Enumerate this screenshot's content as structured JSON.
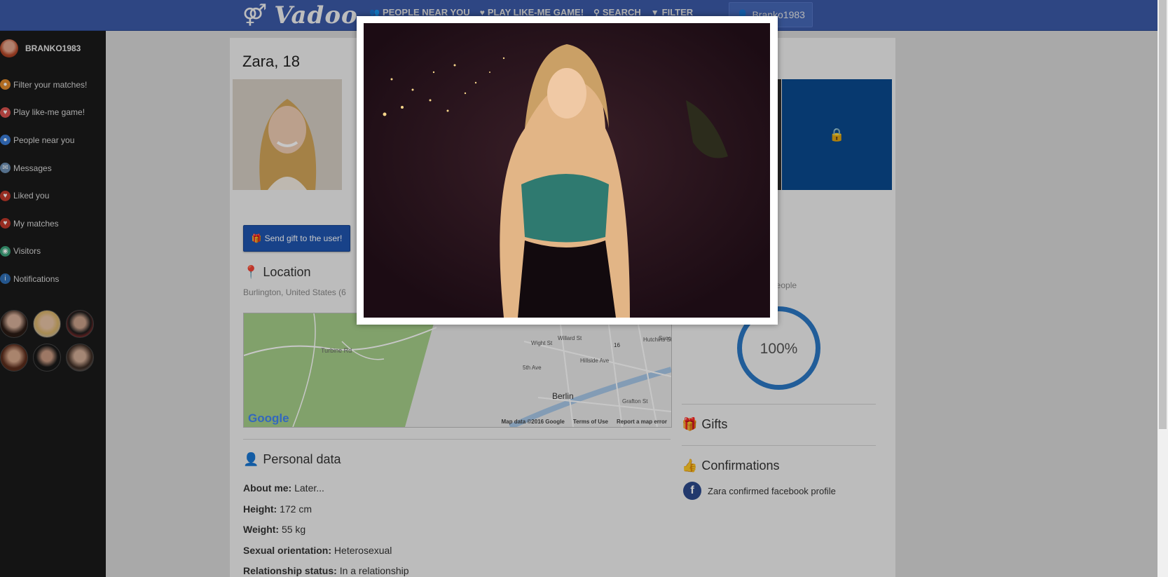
{
  "topbar": {
    "logo_text": "Vadoo",
    "logo_icon": "gender-symbols-icon",
    "nav": [
      {
        "label": "PEOPLE NEAR YOU",
        "icon": "people-icon"
      },
      {
        "label": "PLAY LIKE-ME GAME!",
        "icon": "heart-icon"
      },
      {
        "label": "SEARCH",
        "icon": "search-icon"
      },
      {
        "label": "FILTER",
        "icon": "filter-icon"
      }
    ],
    "user_button": "Branko1983"
  },
  "sidebar": {
    "username": "BRANKO1983",
    "items": [
      {
        "label": "Filter your matches!",
        "color": "#e08a2c"
      },
      {
        "label": "Play like-me game!",
        "color": "#d9534f"
      },
      {
        "label": "People near you",
        "color": "#3a7bd5"
      },
      {
        "label": "Messages",
        "color": "#6c8fb3"
      },
      {
        "label": "Liked you",
        "color": "#c0392b"
      },
      {
        "label": "My matches",
        "color": "#c0392b"
      },
      {
        "label": "Visitors",
        "color": "#3aa37a"
      },
      {
        "label": "Notifications",
        "color": "#2f6fb5"
      }
    ]
  },
  "profile": {
    "name_age": "Zara, 18",
    "gift_button": "Send gift to the user!",
    "location_heading": "Location",
    "location_text": "Burlington, United States (6",
    "map": {
      "labels": [
        "Turbine Rd",
        "Berlin",
        "Wight St",
        "Willard St",
        "Hillside Ave",
        "5th Ave",
        "Grafton St",
        "Hutchins St",
        "Succ",
        "16"
      ],
      "footer": [
        "Map data ©2016 Google",
        "Terms of Use",
        "Report a map error"
      ],
      "google": "Google"
    },
    "personal_heading": "Personal data",
    "personal": [
      {
        "label": "About me:",
        "value": "Later..."
      },
      {
        "label": "Height:",
        "value": "172 cm"
      },
      {
        "label": "Weight:",
        "value": "55 kg"
      },
      {
        "label": "Sexual orientation:",
        "value": "Heterosexual"
      },
      {
        "label": "Relationship status:",
        "value": "In a relationship"
      }
    ],
    "people_text": "people",
    "percent": "100%",
    "gifts_heading": "Gifts",
    "confirmations_heading": "Confirmations",
    "confirmation_text": "Zara confirmed facebook profile"
  }
}
